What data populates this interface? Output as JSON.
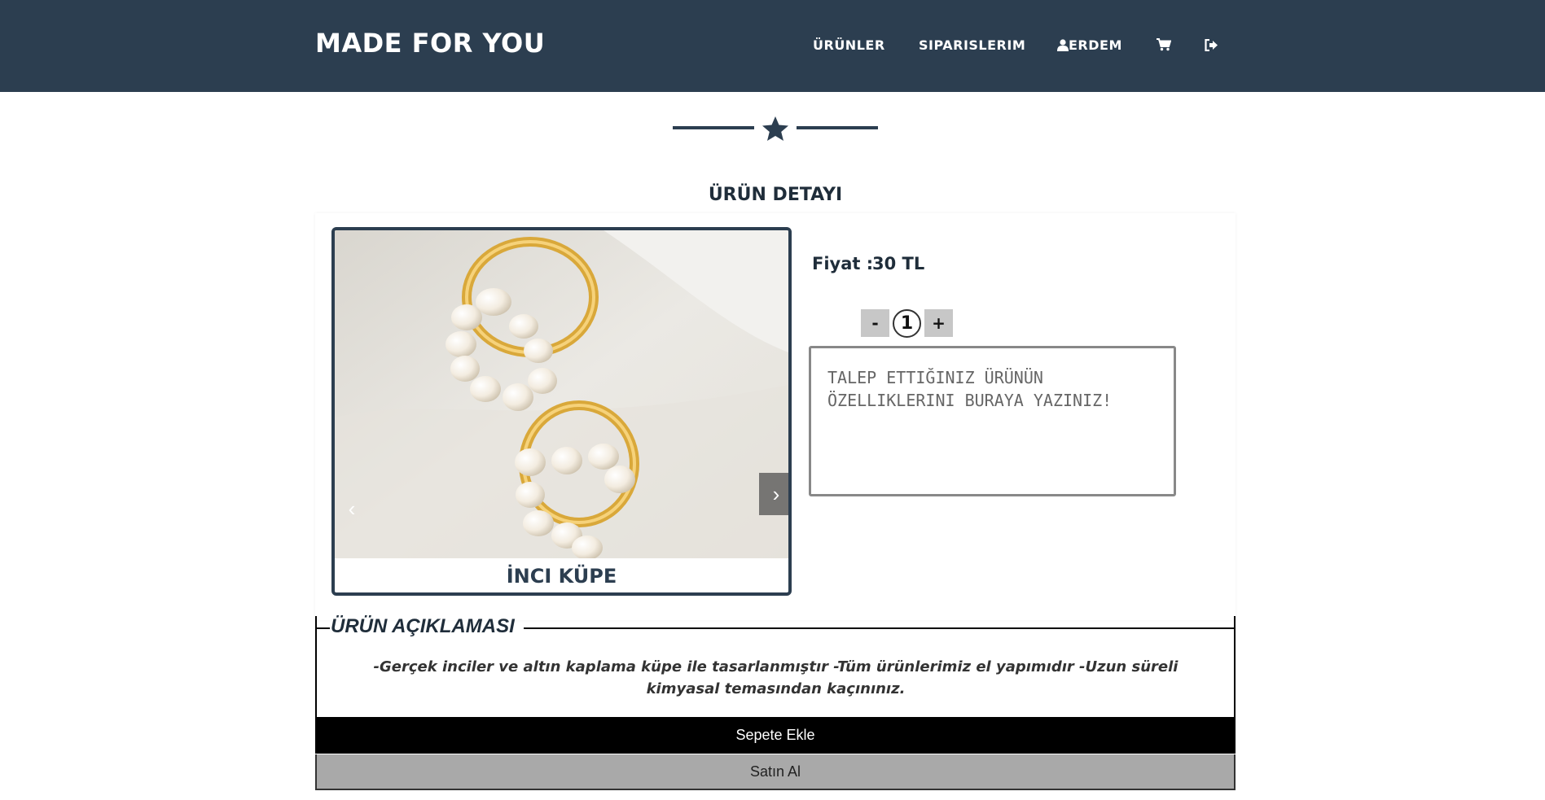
{
  "header": {
    "brand": "MADE FOR YOU",
    "nav": {
      "products": "ÜRÜNLER",
      "orders": "SIPARISLERIM",
      "user": "ERDEM"
    },
    "bg_color": "#2c3e50"
  },
  "page": {
    "title": "ÜRÜN DETAYI"
  },
  "product": {
    "name": "İNCI KÜPE",
    "price_label": "Fiyat :",
    "price_value": "30 TL",
    "quantity": "1",
    "qty_minus": "-",
    "qty_plus": "+",
    "request_placeholder": "TALEP ETTIĞINIZ ÜRÜNÜN ÖZELLIKLERINI BURAYA YAZINIZ!",
    "carousel_prev": "‹",
    "carousel_next": "›"
  },
  "description": {
    "legend": "ÜRÜN AÇIKLAMASI",
    "text": "-Gerçek inciler ve altın kaplama küpe ile tasarlanmıştır -Tüm ürünlerimiz el yapımıdır -Uzun süreli kimyasal temasından kaçınınız."
  },
  "actions": {
    "add_to_cart": "Sepete Ekle",
    "buy": "Satın Al"
  }
}
